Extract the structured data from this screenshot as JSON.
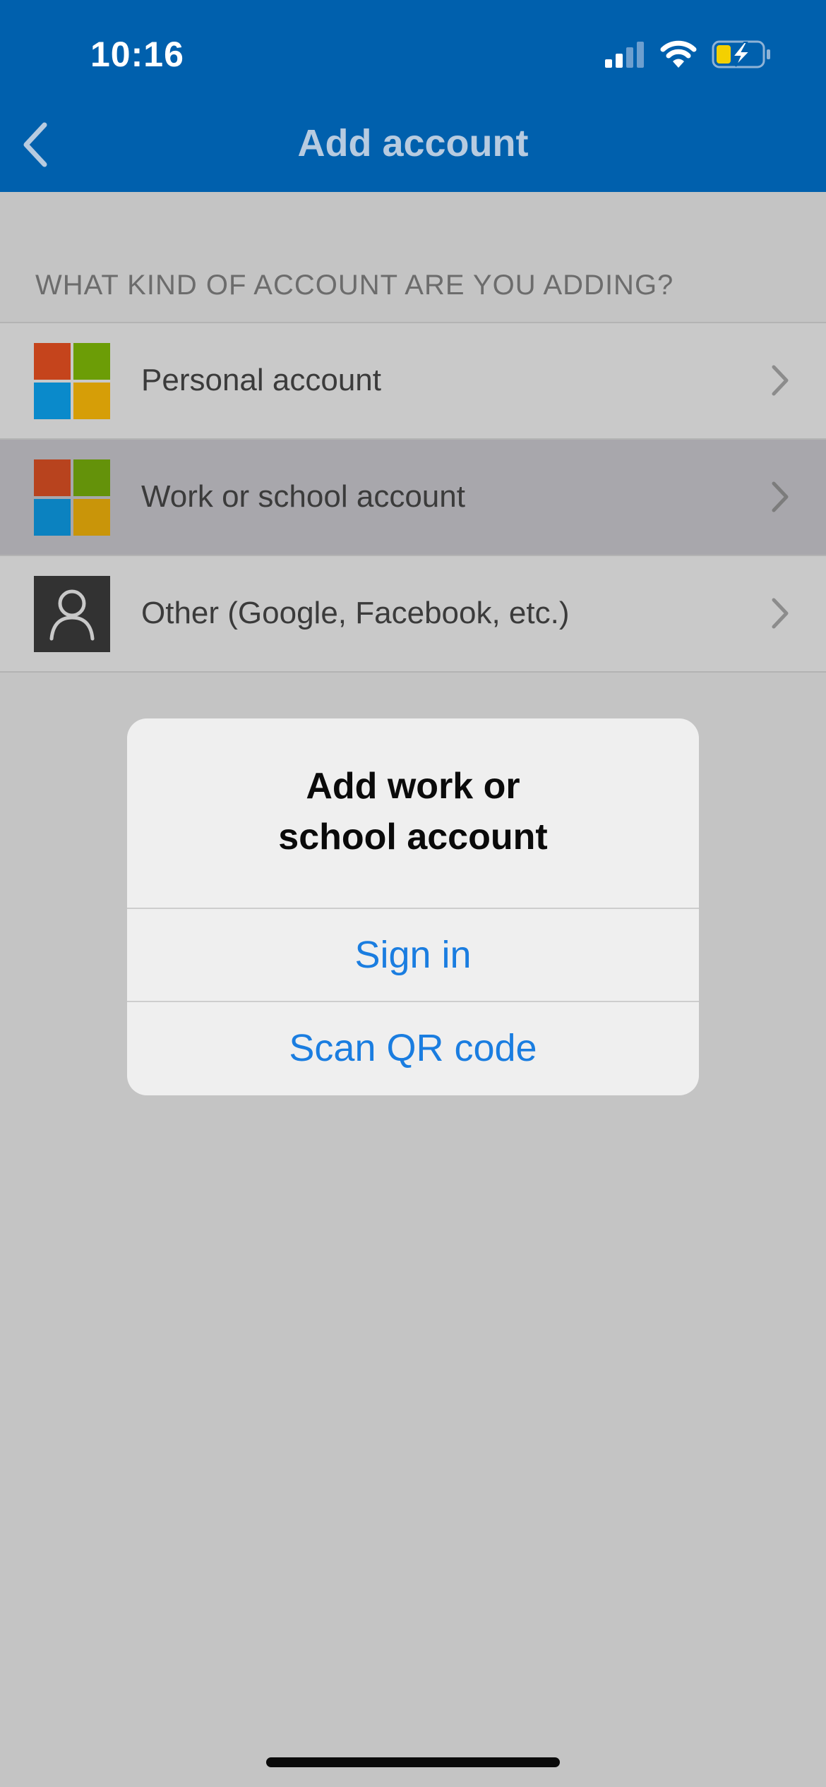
{
  "status_bar": {
    "time": "10:16",
    "icons": [
      "signal-icon",
      "wifi-icon",
      "battery-charging-icon"
    ],
    "battery_color": "#f4d000"
  },
  "nav": {
    "title": "Add account",
    "back_icon": "chevron-left-icon",
    "background": "#0060ad"
  },
  "section": {
    "header": "WHAT KIND OF ACCOUNT ARE YOU ADDING?"
  },
  "accounts": [
    {
      "label": "Personal account",
      "icon": "microsoft-logo-icon",
      "selected": false
    },
    {
      "label": "Work or school account",
      "icon": "microsoft-logo-icon",
      "selected": true
    },
    {
      "label": "Other (Google, Facebook, etc.)",
      "icon": "person-icon",
      "selected": false
    }
  ],
  "microsoft_colors": [
    "#f25022",
    "#7fba00",
    "#00a4ef",
    "#ffb900"
  ],
  "dialog": {
    "title_line1": "Add work or",
    "title_line2": "school account",
    "sign_in_label": "Sign in",
    "scan_qr_label": "Scan QR code",
    "action_color": "#1a7de0"
  }
}
